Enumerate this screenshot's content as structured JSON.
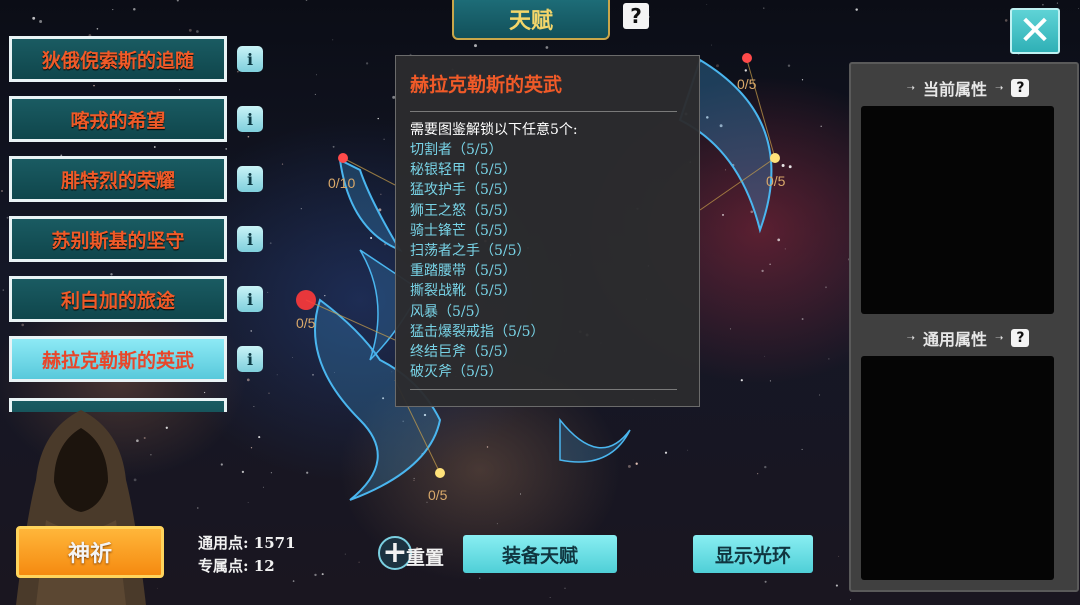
{
  "header": {
    "tab_label": "天赋",
    "help_glyph": "?",
    "close_glyph": "✕"
  },
  "talents": [
    {
      "label": "狄俄倪索斯的追随",
      "info": "i"
    },
    {
      "label": "喀戎的希望",
      "info": "i"
    },
    {
      "label": "腓特烈的荣耀",
      "info": "i"
    },
    {
      "label": "苏别斯基的坚守",
      "info": "i"
    },
    {
      "label": "利白加的旅途",
      "info": "i"
    },
    {
      "label": "赫拉克勒斯的英武",
      "info": "i",
      "selected": true
    }
  ],
  "constellation": {
    "nodes": [
      {
        "label": "0/5"
      },
      {
        "label": "0/10"
      },
      {
        "label": "0/5"
      },
      {
        "label": "0/5"
      },
      {
        "label": "0/5"
      }
    ]
  },
  "tooltip": {
    "title": "赫拉克勒斯的英武",
    "lead": "需要图鉴解锁以下任意5个:",
    "items": [
      "切割者（5/5）",
      "秘银轻甲（5/5）",
      "猛攻护手（5/5）",
      "狮王之怒（5/5）",
      "骑士锋芒（5/5）",
      "扫荡者之手（5/5）",
      "重踏腰带（5/5）",
      "撕裂战靴（5/5）",
      "风暴（5/5）",
      "猛击爆裂戒指（5/5）",
      "终结巨斧（5/5）",
      "破灭斧（5/5）"
    ]
  },
  "attributes": {
    "current_label": "当前属性",
    "general_label": "通用属性",
    "help_glyph": "?"
  },
  "points": {
    "general_label": "通用点:",
    "general_value": "1571",
    "exclusive_label": "专属点:",
    "exclusive_value": "12"
  },
  "actions": {
    "pray": "神祈",
    "reset": "重置",
    "equip": "装备天赋",
    "show_halo": "显示光环"
  },
  "colors": {
    "talent_text": "#f05a28",
    "accent_cyan": "#5fd3d6",
    "gold": "#f3d66a",
    "orange": "#f58a10"
  }
}
